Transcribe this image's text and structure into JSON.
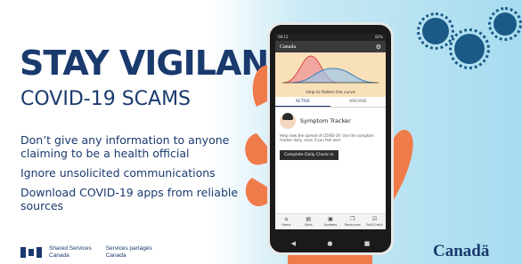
{
  "banner": {
    "headline": "STAY VIGILANT",
    "subhead": "COVID-19 SCAMS",
    "tips": [
      "Don’t give any information to anyone claiming to be a health official",
      "Ignore unsolicited communications",
      "Download COVID-19 apps from reliable sources"
    ]
  },
  "footer": {
    "dept_en_1": "Shared Services",
    "dept_en_2": "Canada",
    "dept_fr_1": "Services partagés",
    "dept_fr_2": "Canada",
    "wordmark": "Canadä"
  },
  "phone": {
    "status_time": "08:12",
    "status_battery": "82%",
    "app_logo": "Canada",
    "curve_caption": "Help to flatten the curve",
    "tabs": [
      "ACTIVE",
      "ARCHIVE"
    ],
    "tracker_title": "Symptom Tracker",
    "tracker_desc": "Help slow the spread of COVID-19. Use the symptom tracker daily, even if you feel well.",
    "checkin_label": "Complete Daily Check-in",
    "nav": [
      "Home",
      "Stats",
      "Updates",
      "Resources",
      "Self-Check"
    ]
  },
  "colors": {
    "brand": "#1a3a6e",
    "virus": "#1b5a86",
    "hand": "#f07b4a"
  }
}
